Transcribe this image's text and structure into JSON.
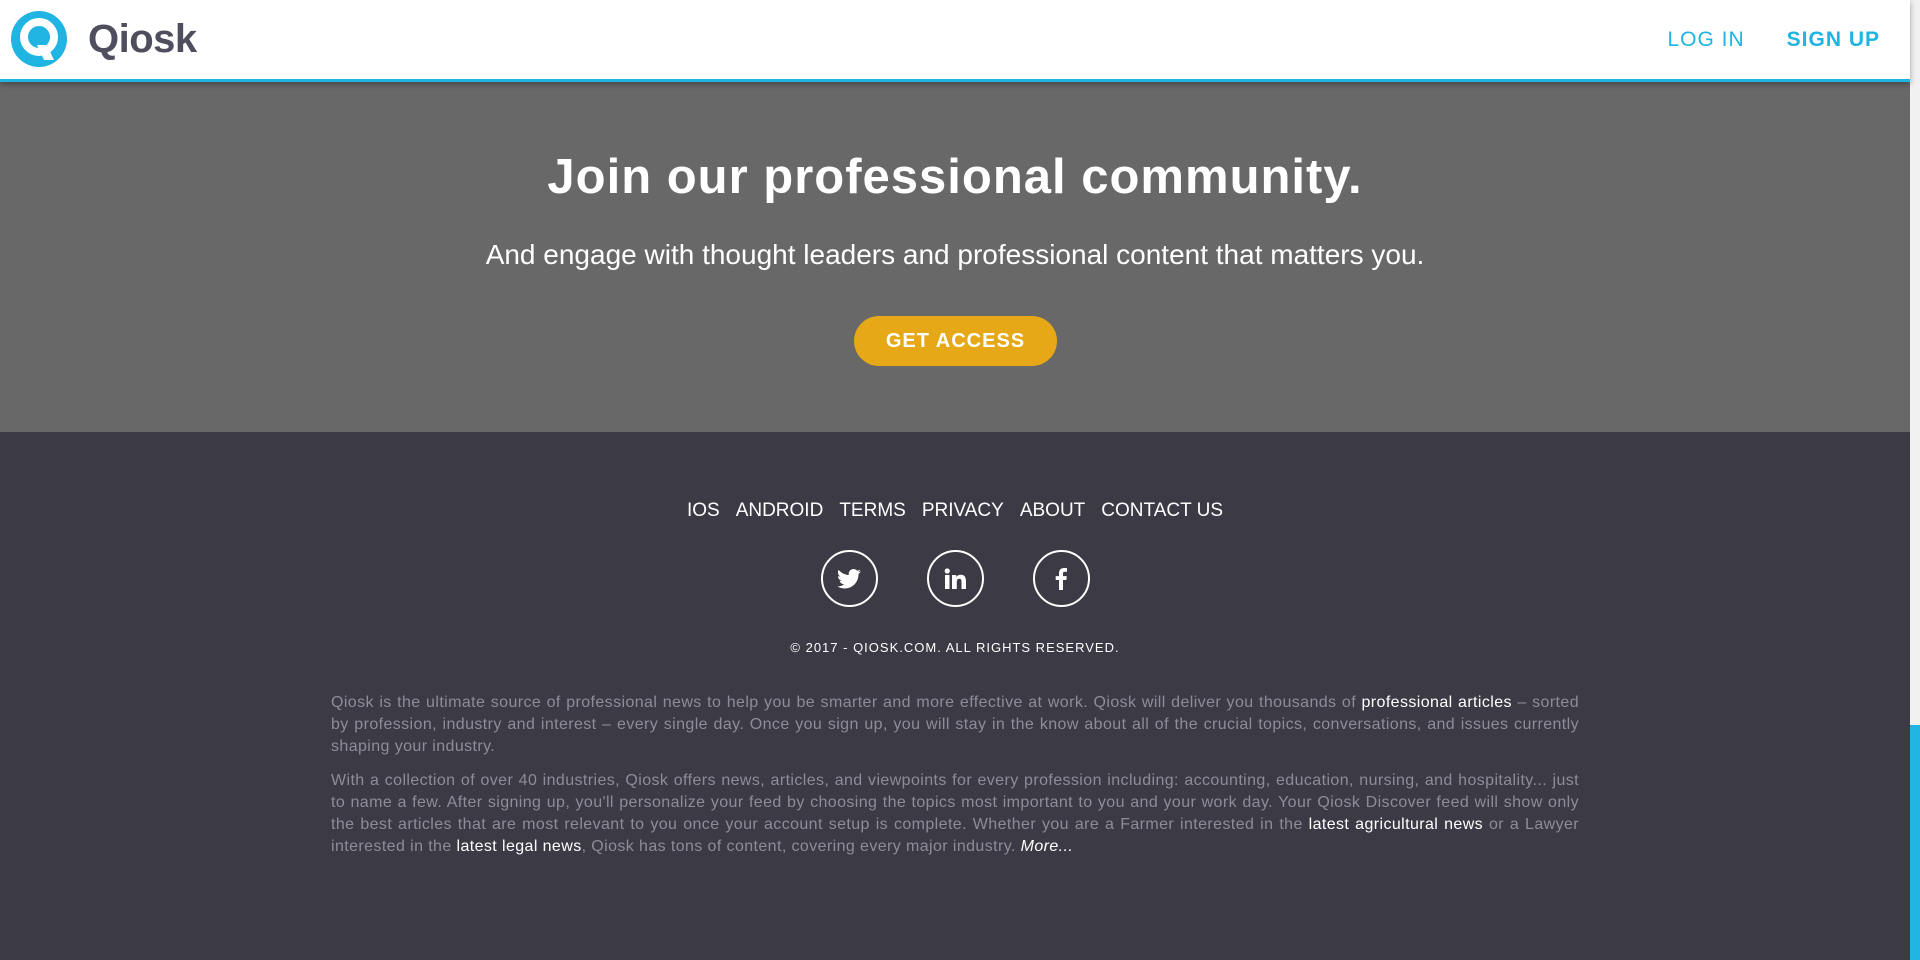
{
  "header": {
    "logo_text": "Qiosk",
    "login_label": "LOG IN",
    "signup_label": "SIGN UP"
  },
  "hero": {
    "title": "Join our professional community.",
    "subtitle": "And engage with thought leaders and professional content that matters you.",
    "cta_label": "GET ACCESS"
  },
  "footer": {
    "nav": [
      "IOS",
      "ANDROID",
      "TERMS",
      "PRIVACY",
      "ABOUT",
      "CONTACT US"
    ],
    "socials": [
      "twitter-icon",
      "linkedin-icon",
      "facebook-icon"
    ],
    "copyright": "© 2017 - QIOSK.COM. ALL RIGHTS RESERVED.",
    "about": {
      "p1_text1": "Qiosk is the ultimate source of professional news to help you be smarter and more effective at work. Qiosk will deliver you thousands of ",
      "p1_link": "professional articles",
      "p1_text2": " – sorted by profession, industry and interest – every single day. Once you sign up, you will stay in the know about all of the crucial topics, conversations, and issues currently shaping your industry.",
      "p2_text1": "With a collection of over 40 industries, Qiosk offers news, articles, and viewpoints for every profession including: accounting, education, nursing, and hospitality... just to name a few. After signing up, you'll personalize your feed by choosing the topics most important to you and your work day. Your Qiosk Discover feed will show only the best articles that are most relevant to you once your account setup is complete. Whether you are a Farmer interested in the ",
      "p2_link1": "latest agricultural news",
      "p2_text2": " or a Lawyer interested in the ",
      "p2_link2": "latest legal news",
      "p2_text3": ", Qiosk has tons of content, covering every major industry. ",
      "more_label": "More..."
    }
  },
  "colors": {
    "brand_blue": "#1fb4e2",
    "cta_gold": "#e6a817",
    "hero_bg": "#686868",
    "footer_bg": "#3b3a45"
  }
}
